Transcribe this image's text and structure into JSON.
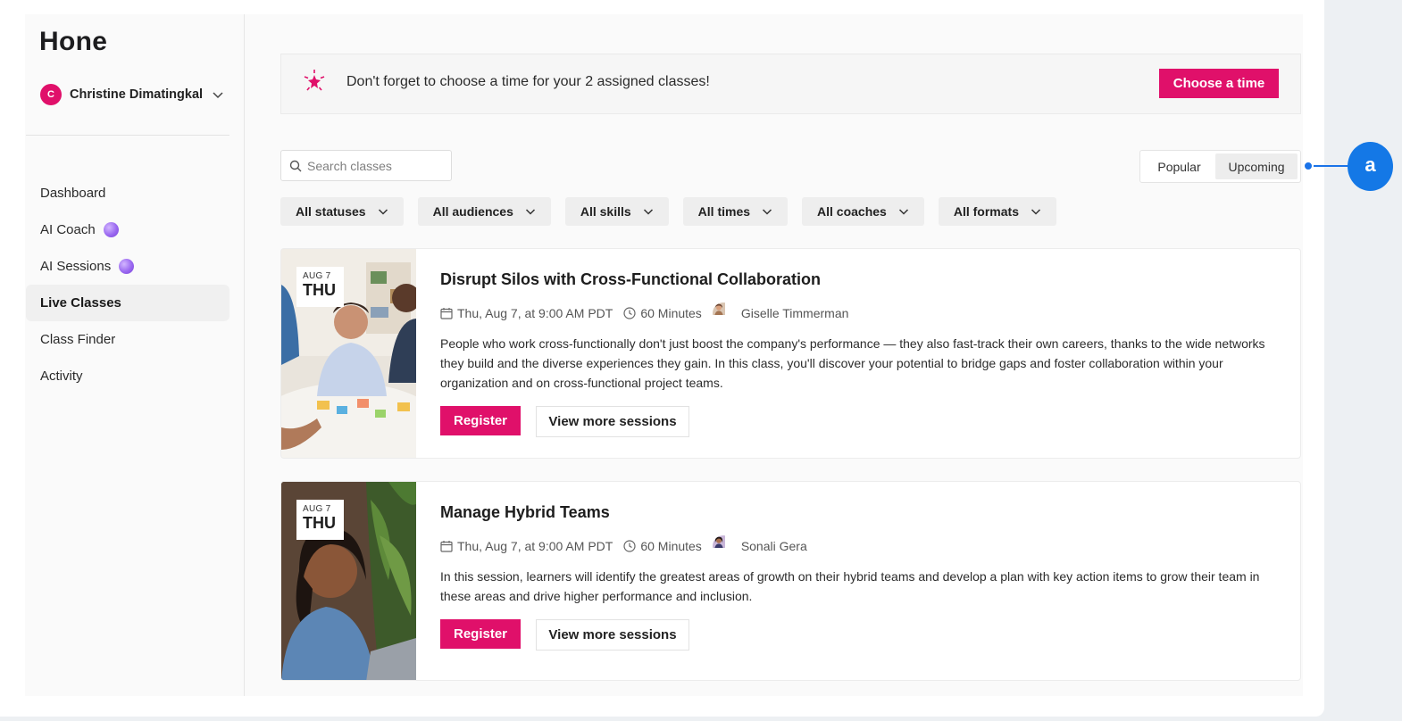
{
  "app": {
    "logo": "Hone"
  },
  "user": {
    "initial": "C",
    "name": "Christine Dimatingkal"
  },
  "sidebar": {
    "items": [
      {
        "label": "Dashboard",
        "badge": false,
        "active": false
      },
      {
        "label": "AI Coach",
        "badge": true,
        "active": false
      },
      {
        "label": "AI Sessions",
        "badge": true,
        "active": false
      },
      {
        "label": "Live Classes",
        "badge": false,
        "active": true
      },
      {
        "label": "Class Finder",
        "badge": false,
        "active": false
      },
      {
        "label": "Activity",
        "badge": false,
        "active": false
      }
    ]
  },
  "banner": {
    "icon": "sparkle-icon",
    "text": "Don't forget to choose a time for your 2 assigned classes!",
    "button": "Choose a time"
  },
  "search": {
    "placeholder": "Search classes",
    "value": ""
  },
  "sort": {
    "options": [
      "Popular",
      "Upcoming"
    ],
    "selected": "Upcoming"
  },
  "filters": [
    "All statuses",
    "All audiences",
    "All skills",
    "All times",
    "All coaches",
    "All formats"
  ],
  "classes": [
    {
      "month": "AUG 7",
      "weekday": "THU",
      "title": "Disrupt Silos with Cross-Functional Collaboration",
      "datetime": "Thu, Aug 7, at 9:00 AM PDT",
      "duration": "60 Minutes",
      "coach": "Giselle Timmerman",
      "description": "People who work cross-functionally don't just boost the company's performance — they also fast-track their own careers, thanks to the wide networks they build and the diverse experiences they gain. In this class, you'll discover your potential to bridge gaps and foster collaboration within your organization and on cross-functional project teams.",
      "register": "Register",
      "more": "View more sessions"
    },
    {
      "month": "AUG 7",
      "weekday": "THU",
      "title": "Manage Hybrid Teams",
      "datetime": "Thu, Aug 7, at 9:00 AM PDT",
      "duration": "60 Minutes",
      "coach": "Sonali Gera",
      "description": "In this session, learners will identify the greatest areas of growth on their hybrid teams and develop a plan with key action items to grow their team in these areas and drive higher performance and inclusion.",
      "register": "Register",
      "more": "View more sessions"
    }
  ],
  "annotation": {
    "label": "a"
  },
  "colors": {
    "brand": "#e0106a",
    "annotation": "#1478e6",
    "ai_badge": "#9a68f0"
  }
}
